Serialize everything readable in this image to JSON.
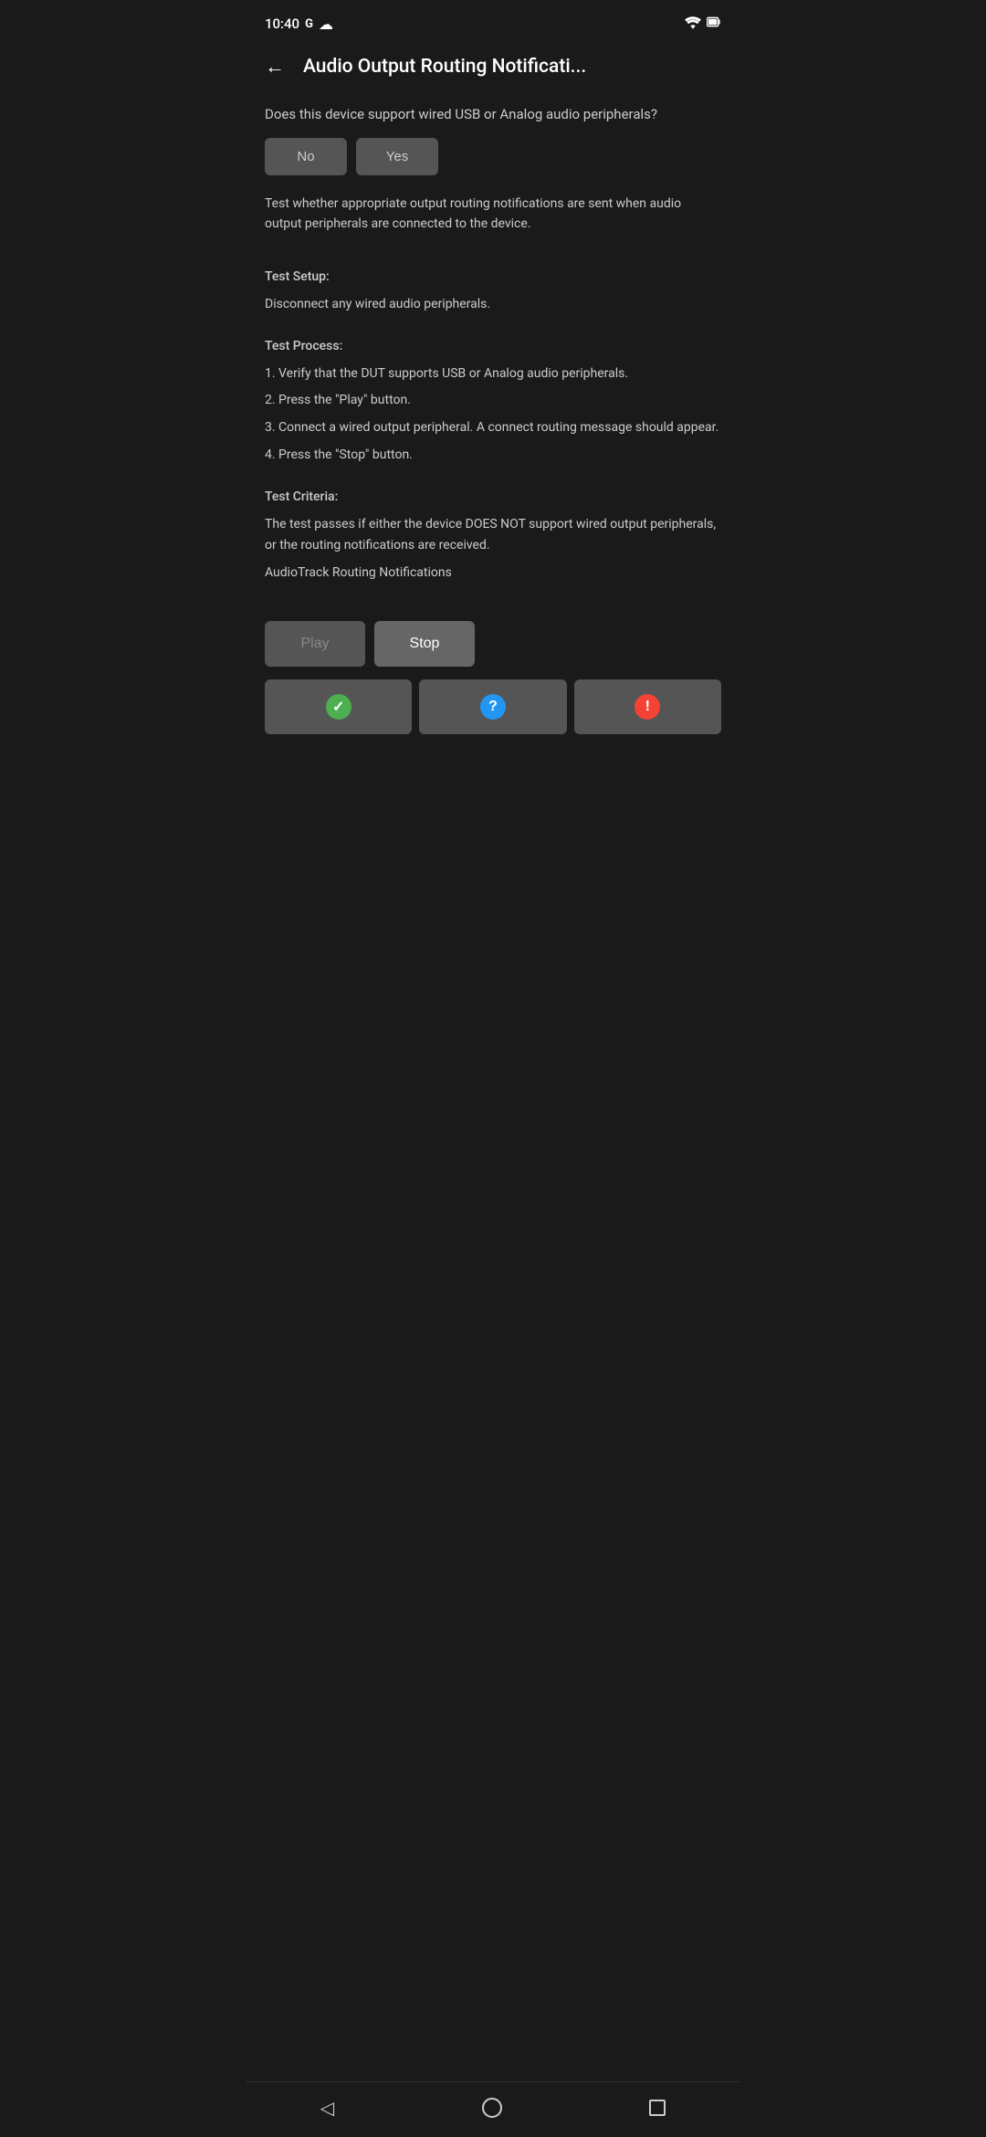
{
  "statusBar": {
    "time": "10:40",
    "googleLabel": "G",
    "cloudLabel": "☁",
    "wifiLabel": "wifi",
    "batteryLabel": "battery"
  },
  "appBar": {
    "backLabel": "←",
    "title": "Audio Output Routing Notificati..."
  },
  "content": {
    "questionText": "Does this device support wired USB or Analog audio peripherals?",
    "noButtonLabel": "No",
    "yesButtonLabel": "Yes",
    "descriptionText": "Test whether appropriate output routing notifications are sent when audio output peripherals are connected to the device.",
    "testSetupTitle": "Test Setup:",
    "testSetupBody": "Disconnect any wired audio peripherals.",
    "testProcessTitle": "Test Process:",
    "testProcessLines": [
      "1. Verify that the DUT supports USB or Analog audio peripherals.",
      "2. Press the \"Play\" button.",
      "3. Connect a wired output peripheral. A connect routing message should appear.",
      "4. Press the \"Stop\" button."
    ],
    "testCriteriaTitle": "Test Criteria:",
    "testCriteriaBody": "The test passes if either the device DOES NOT support wired output peripherals, or the routing notifications are received.",
    "audioTrackLabel": "AudioTrack Routing Notifications"
  },
  "playback": {
    "playButtonLabel": "Play",
    "stopButtonLabel": "Stop"
  },
  "resultButtons": {
    "passIcon": "✓",
    "infoIcon": "?",
    "failIcon": "!"
  },
  "bottomNav": {
    "backIcon": "◁",
    "homeIcon": "",
    "recentIcon": ""
  }
}
